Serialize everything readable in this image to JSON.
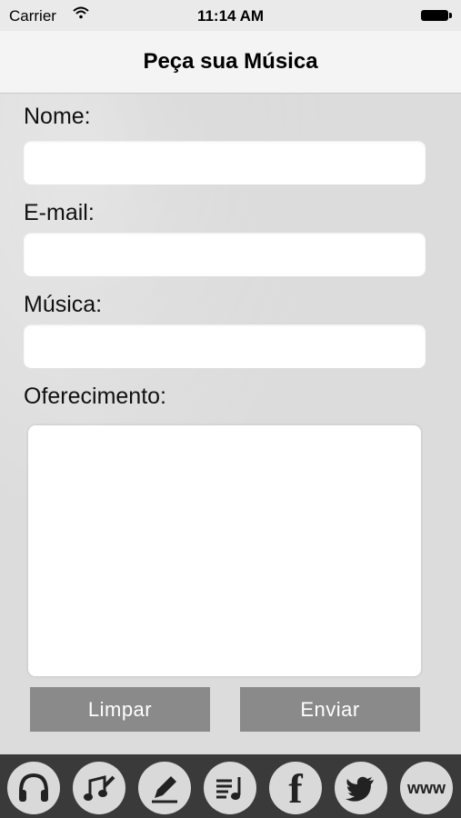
{
  "status_bar": {
    "carrier": "Carrier",
    "time": "11:14 AM"
  },
  "nav": {
    "title": "Peça sua Música"
  },
  "form": {
    "nome_label": "Nome:",
    "email_label": "E-mail:",
    "musica_label": "Música:",
    "oferecimento_label": "Oferecimento:",
    "nome_value": "",
    "email_value": "",
    "musica_value": "",
    "oferecimento_value": ""
  },
  "buttons": {
    "limpar": "Limpar",
    "enviar": "Enviar"
  },
  "tabs": [
    {
      "icon": "headphones-icon"
    },
    {
      "icon": "music-edit-icon"
    },
    {
      "icon": "pencil-icon"
    },
    {
      "icon": "playlist-icon"
    },
    {
      "icon": "facebook-icon",
      "text": "f"
    },
    {
      "icon": "twitter-icon"
    },
    {
      "icon": "www-icon",
      "text": "www"
    }
  ]
}
